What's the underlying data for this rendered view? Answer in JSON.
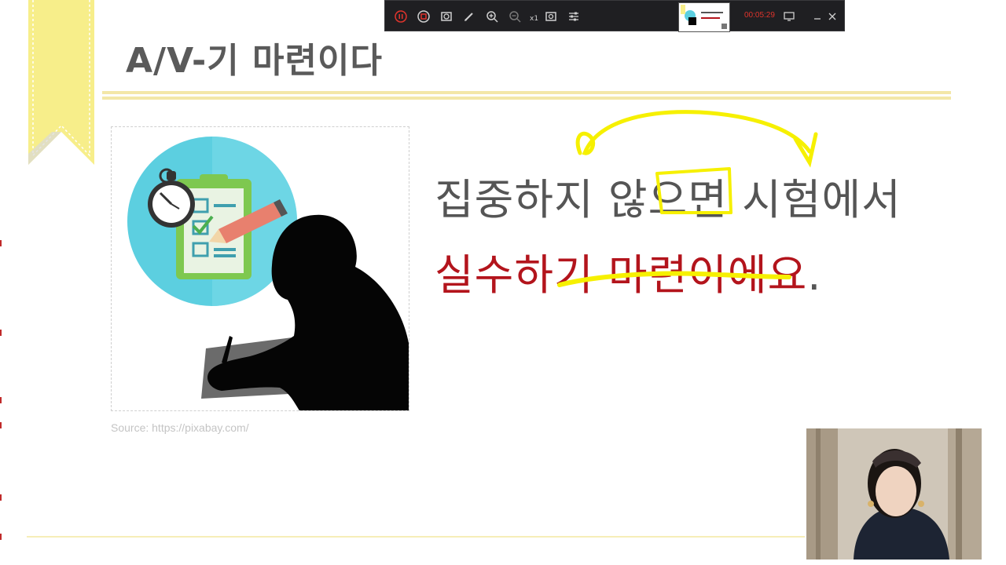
{
  "slide": {
    "title": "A/V-기 마련이다",
    "source_text": "Source: https://pixabay.com/",
    "example": {
      "line1": "집중하지 않으면 시험에서",
      "line2_main": "실수하기 마련이에요",
      "line2_period": "."
    }
  },
  "recorder": {
    "speed_label": "x1",
    "timer": "00:05:29",
    "buttons": [
      "pause-icon",
      "stop-icon",
      "camera-icon",
      "pen-icon",
      "zoom-in-icon",
      "zoom-out-icon",
      "webcam-icon",
      "settings-icon",
      "minimize-icon",
      "close-icon"
    ]
  },
  "colors": {
    "title_gray": "#5a5a5a",
    "accent_red": "#b3141c",
    "ribbon_yellow": "#f7ee8a",
    "highlight_yellow": "#f6f000",
    "timer_red": "#e0342c"
  }
}
